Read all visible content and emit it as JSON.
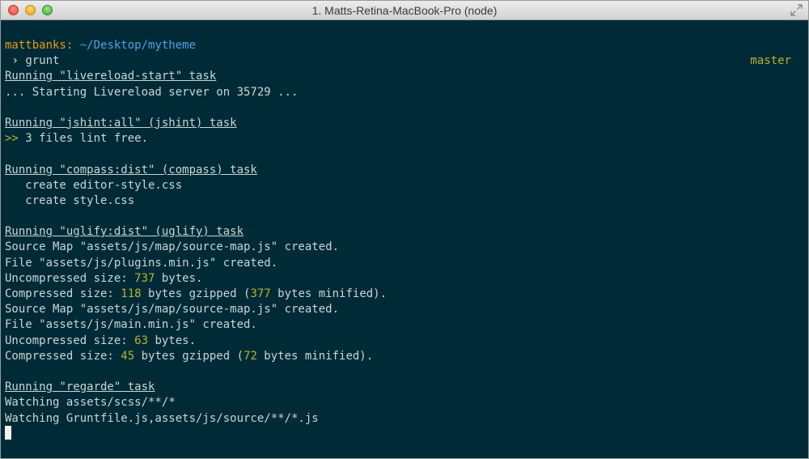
{
  "window": {
    "title": "1. Matts-Retina-MacBook-Pro (node)"
  },
  "prompt": {
    "user": "mattbanks:",
    "path": "~/Desktop/mytheme",
    "command": "grunt",
    "branch": "master"
  },
  "output": {
    "task1_header": "Running \"livereload-start\" task",
    "task1_line1": "... Starting Livereload server on 35729 ...",
    "task2_header": "Running \"jshint:all\" (jshint) task",
    "task2_arrow": ">>",
    "task2_line1": "3 files lint free.",
    "task3_header": "Running \"compass:dist\" (compass) task",
    "task3_line1": "   create editor-style.css",
    "task3_line2": "   create style.css",
    "task4_header": "Running \"uglify:dist\" (uglify) task",
    "task4_sourcemap1": "Source Map \"assets/js/map/source-map.js\" created.",
    "task4_file1": "File \"assets/js/plugins.min.js\" created.",
    "task4_uncompressed_label": "Uncompressed size: ",
    "task4_uncompressed1": "737",
    "task4_bytes_dot": " bytes.",
    "task4_compressed_label": "Compressed size: ",
    "task4_compressed1": "118",
    "task4_gzipped_open": " bytes gzipped (",
    "task4_minified1": "377",
    "task4_minified_close": " bytes minified).",
    "task4_sourcemap2": "Source Map \"assets/js/map/source-map.js\" created.",
    "task4_file2": "File \"assets/js/main.min.js\" created.",
    "task4_uncompressed2": "63",
    "task4_compressed2": "45",
    "task4_minified2": "72",
    "task5_header": "Running \"regarde\" task",
    "task5_line1": "Watching assets/scss/**/*",
    "task5_line2": "Watching Gruntfile.js,assets/js/source/**/*.js"
  },
  "colors": {
    "background": "#002b36",
    "text": "#c8d6d8",
    "user": "#e59b15",
    "path": "#51a0e6",
    "highlight": "#b7b233"
  },
  "icons": {
    "close": "close-button-red",
    "minimize": "minimize-button-yellow",
    "zoom": "zoom-button-green",
    "fullscreen": "fullscreen-arrows-icon"
  }
}
